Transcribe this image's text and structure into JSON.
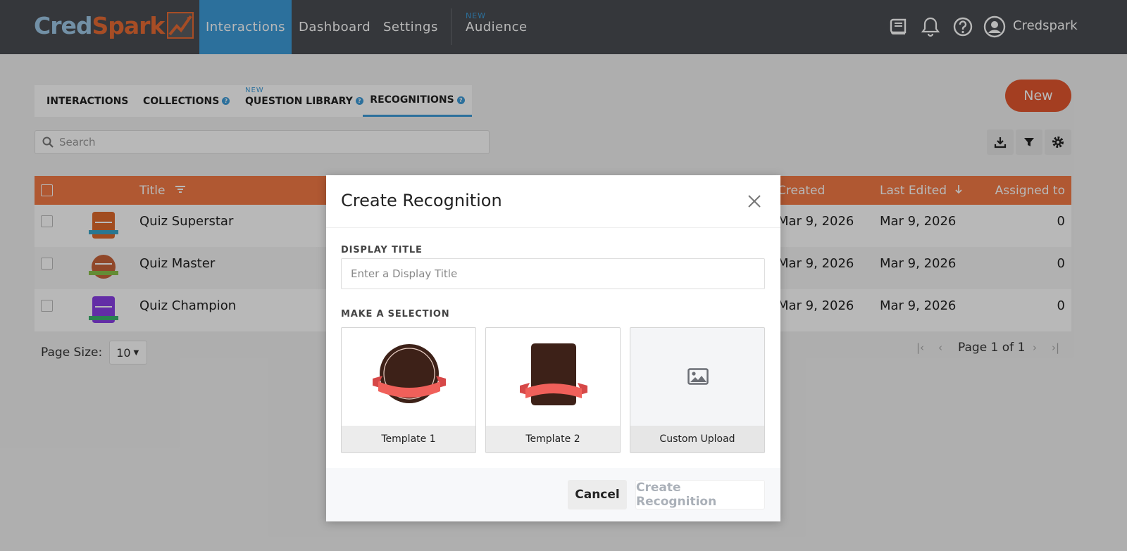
{
  "app": {
    "logo_left": "Cred",
    "logo_right": "Spark",
    "colors": {
      "nav_bg": "#4a4d52",
      "active_nav": "#3d9bd8",
      "brand_orange": "#e4572e",
      "table_header": "#f47a46"
    }
  },
  "nav": {
    "items": [
      {
        "label": "Interactions",
        "active": true
      },
      {
        "label": "Dashboard",
        "active": false
      },
      {
        "label": "Settings",
        "active": false
      }
    ],
    "audience_tag": "NEW",
    "audience_label": "Audience",
    "icons": [
      "book-icon",
      "bell-icon",
      "help-icon",
      "user-avatar-icon"
    ],
    "user_name": "Credspark"
  },
  "tabs": {
    "items": [
      {
        "label": "INTERACTIONS",
        "help": false,
        "active": false
      },
      {
        "label": "COLLECTIONS",
        "help": true,
        "active": false
      },
      {
        "label": "QUESTION LIBRARY",
        "help": true,
        "active": false,
        "tag": "NEW"
      },
      {
        "label": "RECOGNITIONS",
        "help": true,
        "active": true
      }
    ],
    "help_glyph": "?"
  },
  "new_button": "New",
  "search": {
    "placeholder": "Search"
  },
  "toolbar": {
    "icons": [
      "download-icon",
      "filter-icon",
      "settings-icon"
    ]
  },
  "table": {
    "headers": {
      "title": "Title",
      "created": "Created",
      "last_edited": "Last Edited",
      "assigned": "Assigned to"
    },
    "rows": [
      {
        "title": "Quiz Superstar",
        "created": "Mar 9, 2026",
        "last_edited": "Mar 9, 2026",
        "assigned": "0",
        "badge_color": "#e06a2c",
        "ribbon_color": "#3aa6c9"
      },
      {
        "title": "Quiz Master",
        "created": "Mar 9, 2026",
        "last_edited": "Mar 9, 2026",
        "assigned": "0",
        "badge_color": "#c8633a",
        "ribbon_color": "#8bc34a"
      },
      {
        "title": "Quiz Champion",
        "created": "Mar 9, 2026",
        "last_edited": "Mar 9, 2026",
        "assigned": "0",
        "badge_color": "#8a3fe6",
        "ribbon_color": "#3cb371"
      }
    ]
  },
  "pagination": {
    "page_size_label": "Page Size:",
    "page_size_value": "10",
    "page_text": "Page 1 of 1"
  },
  "modal": {
    "title": "Create Recognition",
    "display_title_label": "DISPLAY TITLE",
    "display_title_placeholder": "Enter a Display Title",
    "selection_label": "MAKE A SELECTION",
    "options": [
      {
        "label": "Template 1"
      },
      {
        "label": "Template 2"
      },
      {
        "label": "Custom Upload"
      }
    ],
    "cancel_label": "Cancel",
    "create_label": "Create Recognition"
  }
}
